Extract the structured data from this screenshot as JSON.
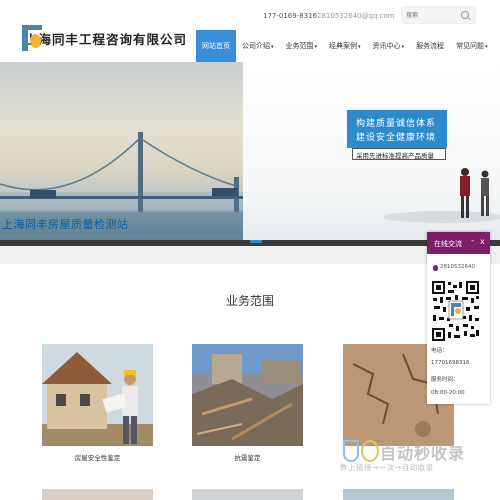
{
  "header": {
    "logo_text": "上海同丰工程咨询有限公司",
    "phone": "177-0169-8316",
    "separator": "|",
    "email": "2810532640@qq.com",
    "search": {
      "placeholder": "搜索"
    }
  },
  "nav": {
    "items": [
      {
        "label": "网站首页",
        "active": true,
        "caret": ""
      },
      {
        "label": "公司介绍",
        "caret": "▾"
      },
      {
        "label": "业务范围",
        "caret": "▾"
      },
      {
        "label": "经典案例",
        "caret": "▾"
      },
      {
        "label": "资讯中心",
        "caret": "▾"
      },
      {
        "label": "服务流程",
        "caret": ""
      },
      {
        "label": "常见问题",
        "caret": "▾"
      }
    ]
  },
  "banner": {
    "caption": "上海同丰房屋质量检测站",
    "slogan_line1": "构建质量诚信体系",
    "slogan_line2": "建设安全健康环境",
    "slogan_line3": "采用先进标准提高产品质量"
  },
  "section": {
    "title": "业务范围",
    "cards": [
      {
        "label": "房屋安全性鉴定"
      },
      {
        "label": "抗震鉴定"
      },
      {
        "label": ""
      }
    ]
  },
  "chat": {
    "title": "在线交流",
    "minimize": "-",
    "close": "x",
    "qq": "2810532640",
    "phone_label": "电话：",
    "phone": "17701698316",
    "hours_label": "服务时间：",
    "hours": "08:00-20:00"
  },
  "watermark": {
    "title": "自动秒收录",
    "subtitle": "数上链接→一次→自动收录"
  },
  "colors": {
    "nav_active": "#3a8fd8",
    "chat_header": "#7c1e6a",
    "banner_caption": "#0a5ea0",
    "slogan_box": "#2e8bcb"
  }
}
